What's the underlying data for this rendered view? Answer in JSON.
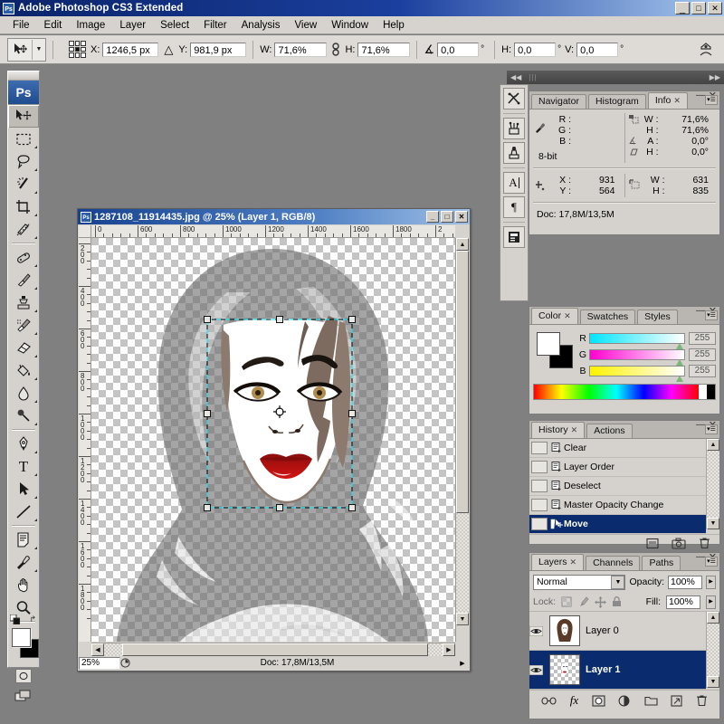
{
  "window": {
    "title": "Adobe Photoshop CS3 Extended",
    "app_icon": "Ps",
    "minimize": "_",
    "maximize": "□",
    "close": "✕"
  },
  "menubar": {
    "items": [
      "File",
      "Edit",
      "Image",
      "Layer",
      "Select",
      "Filter",
      "Analysis",
      "View",
      "Window",
      "Help"
    ]
  },
  "options_bar": {
    "tool_icon": "move-tool-icon",
    "x_label": "X:",
    "x_value": "1246,5 px",
    "delta_icon": "△",
    "y_label": "Y:",
    "y_value": "981,9 px",
    "w_label": "W:",
    "w_value": "71,6%",
    "link_icon": "chain-link-icon",
    "h_label": "H:",
    "h_value": "71,6%",
    "angle_icon": "∡",
    "angle_value": "0,0",
    "degree": "°",
    "skew_h_label": "H:",
    "skew_h_value": "0,0",
    "skew_v_label": "V:",
    "skew_v_value": "0,0",
    "bridge_icon": "go-to-bridge-icon"
  },
  "toolbox": {
    "logo": "Ps",
    "tools": [
      {
        "name": "move-tool",
        "selected": true
      },
      {
        "name": "rectangular-marquee-tool",
        "selected": false
      },
      {
        "name": "lasso-tool",
        "selected": false
      },
      {
        "name": "magic-wand-tool",
        "selected": false
      },
      {
        "name": "crop-tool",
        "selected": false
      },
      {
        "name": "slice-tool",
        "selected": false
      },
      {
        "name": "healing-brush-tool",
        "selected": false
      },
      {
        "name": "brush-tool",
        "selected": false
      },
      {
        "name": "clone-stamp-tool",
        "selected": false
      },
      {
        "name": "history-brush-tool",
        "selected": false
      },
      {
        "name": "eraser-tool",
        "selected": false
      },
      {
        "name": "paint-bucket-tool",
        "selected": false
      },
      {
        "name": "blur-tool",
        "selected": false
      },
      {
        "name": "dodge-tool",
        "selected": false
      },
      {
        "name": "pen-tool",
        "selected": false
      },
      {
        "name": "type-tool",
        "selected": false
      },
      {
        "name": "path-selection-tool",
        "selected": false
      },
      {
        "name": "line-tool",
        "selected": false
      },
      {
        "name": "notes-tool",
        "selected": false
      },
      {
        "name": "eyedropper-tool",
        "selected": false
      },
      {
        "name": "hand-tool",
        "selected": false
      },
      {
        "name": "zoom-tool",
        "selected": false
      }
    ],
    "foreground_color": "#ffffff",
    "background_color": "#000000",
    "type_tool_glyph": "T"
  },
  "document": {
    "title": "1287108_11914435.jpg @ 25% (Layer 1, RGB/8)",
    "minimize": "_",
    "maximize": "□",
    "close": "✕",
    "zoom": "25%",
    "doc_size": "Doc: 17,8M/13,5M",
    "ruler_h_labels": [
      "0",
      "600",
      "800",
      "1000",
      "1200",
      "1400",
      "1600",
      "1800",
      "2"
    ],
    "ruler_v_labels": [
      "200",
      "400",
      "600",
      "800",
      "1000",
      "1200",
      "1400",
      "1600",
      "1800"
    ]
  },
  "dock": {
    "collapse_left": "◀◀",
    "expand_right": "▶▶",
    "icons": [
      "tool-presets-icon",
      "brushes-icon",
      "clone-source-icon",
      "character-icon",
      "paragraph-icon",
      "layer-comps-icon"
    ]
  },
  "info_panel": {
    "tabs": [
      {
        "label": "Navigator",
        "active": false,
        "closable": false
      },
      {
        "label": "Histogram",
        "active": false,
        "closable": false
      },
      {
        "label": "Info",
        "active": true,
        "closable": true
      }
    ],
    "eyedropper_icon": "eyedropper-icon",
    "rgb": [
      {
        "key": "R :",
        "value": ""
      },
      {
        "key": "G :",
        "value": ""
      },
      {
        "key": "B :",
        "value": ""
      }
    ],
    "depth": "8-bit",
    "transform": [
      {
        "icon": "scale-icon",
        "key": "W :",
        "value": "71,6%"
      },
      {
        "icon": "",
        "key": "H :",
        "value": "71,6%"
      },
      {
        "icon": "angle-icon",
        "key": "A :",
        "value": "0,0°"
      },
      {
        "icon": "skew-icon",
        "key": "H :",
        "value": "0,0°"
      }
    ],
    "pointer": [
      {
        "key": "X :",
        "value": "931"
      },
      {
        "key": "Y :",
        "value": "564"
      }
    ],
    "marquee": [
      {
        "key": "W :",
        "value": "631"
      },
      {
        "key": "H :",
        "value": "835"
      }
    ],
    "doc_line": "Doc: 17,8M/13,5M"
  },
  "color_panel": {
    "tabs": [
      {
        "label": "Color",
        "active": true,
        "closable": true
      },
      {
        "label": "Swatches",
        "active": false,
        "closable": false
      },
      {
        "label": "Styles",
        "active": false,
        "closable": false
      }
    ],
    "foreground_color": "#ffffff",
    "background_color": "#000000",
    "channels": [
      {
        "label": "R",
        "value": "255",
        "from": "#00e5ff",
        "to": "#ffffff"
      },
      {
        "label": "G",
        "value": "255",
        "from": "#ff00d0",
        "to": "#ffffff"
      },
      {
        "label": "B",
        "value": "255",
        "from": "#fff200",
        "to": "#ffffff"
      }
    ]
  },
  "history_panel": {
    "tabs": [
      {
        "label": "History",
        "active": true,
        "closable": true
      },
      {
        "label": "Actions",
        "active": false,
        "closable": false
      }
    ],
    "items": [
      {
        "label": "Clear",
        "selected": false
      },
      {
        "label": "Layer Order",
        "selected": false
      },
      {
        "label": "Deselect",
        "selected": false
      },
      {
        "label": "Master Opacity Change",
        "selected": false
      },
      {
        "label": "Move",
        "selected": true
      }
    ],
    "buttons": [
      "new-document-from-state-icon",
      "new-snapshot-icon",
      "delete-icon"
    ]
  },
  "layers_panel": {
    "tabs": [
      {
        "label": "Layers",
        "active": true,
        "closable": true
      },
      {
        "label": "Channels",
        "active": false,
        "closable": false
      },
      {
        "label": "Paths",
        "active": false,
        "closable": false
      }
    ],
    "blend_mode": "Normal",
    "opacity_label": "Opacity:",
    "opacity_value": "100%",
    "lock_label": "Lock:",
    "lock_icons": [
      "lock-transparency-icon",
      "lock-image-icon",
      "lock-position-icon",
      "lock-all-icon"
    ],
    "fill_label": "Fill:",
    "fill_value": "100%",
    "layers": [
      {
        "name": "Layer 0",
        "visible": true,
        "selected": false,
        "thumb": "portrait"
      },
      {
        "name": "Layer 1",
        "visible": true,
        "selected": true,
        "thumb": "face-transparent"
      }
    ],
    "buttons": [
      "link-layers-icon",
      "layer-style-icon",
      "layer-mask-icon",
      "adjustment-layer-icon",
      "new-group-icon",
      "new-layer-icon",
      "delete-layer-icon"
    ]
  },
  "canvas": {
    "selection": {
      "color": "#00f0ff",
      "handles": 8
    },
    "colors": {
      "hair_dark": "#7d6b60",
      "hair_light": "#d9d4cd",
      "skin": "#ffffff",
      "lips": "#a81414",
      "eye_iris": "#b08b4e",
      "checker_light": "#ffffff",
      "checker_dark": "#bfbfbf"
    }
  }
}
